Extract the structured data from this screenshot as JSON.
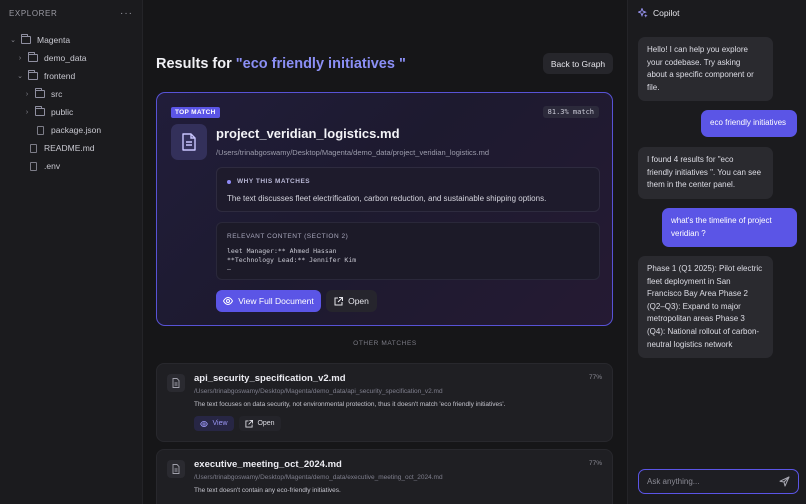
{
  "explorer": {
    "title": "EXPLORER",
    "more": "···",
    "tree": [
      {
        "label": "Magenta",
        "type": "folder",
        "chevron": "open"
      },
      {
        "label": "demo_data",
        "type": "folder",
        "chevron": "closed"
      },
      {
        "label": "frontend",
        "type": "folder",
        "chevron": "open"
      },
      {
        "label": "src",
        "type": "folder",
        "chevron": "closed"
      },
      {
        "label": "public",
        "type": "folder",
        "chevron": "closed"
      },
      {
        "label": "package.json",
        "type": "file"
      },
      {
        "label": "README.md",
        "type": "file"
      },
      {
        "label": ".env",
        "type": "file"
      }
    ]
  },
  "results": {
    "title_prefix": "Results for ",
    "query": "\"eco friendly initiatives \"",
    "back_label": "Back to Graph"
  },
  "top_match": {
    "badge": "TOP MATCH",
    "match": "81.3% match",
    "name": "project_veridian_logistics.md",
    "path": "/Users/trinabgoswamy/Desktop/Magenta/demo_data/project_veridian_logistics.md",
    "why_title": "WHY THIS MATCHES",
    "why_text": "The text discusses fleet electrification, carbon reduction, and sustainable shipping options.",
    "relevant_title": "RELEVANT CONTENT (SECTION 2)",
    "relevant_lines": [
      "leet Manager:** Ahmed Hassan",
      "**Technology Lead:** Jennifer Kim",
      "–"
    ],
    "view_label": "View Full Document",
    "open_label": "Open"
  },
  "other_label": "OTHER MATCHES",
  "other_matches": [
    {
      "name": "api_security_specification_v2.md",
      "pct": "77%",
      "path": "/Users/trinabgoswamy/Desktop/Magenta/demo_data/api_security_specification_v2.md",
      "text": "The text focuses on data security, not environmental protection, thus it doesn't match 'eco friendly initiatives'.",
      "view_label": "View",
      "open_label": "Open"
    },
    {
      "name": "executive_meeting_oct_2024.md",
      "pct": "77%",
      "path": "/Users/trinabgoswamy/Desktop/Magenta/demo_data/executive_meeting_oct_2024.md",
      "text": "The text doesn't contain any eco-friendly initiatives."
    }
  ],
  "copilot": {
    "title": "Copilot",
    "messages": [
      {
        "role": "bot",
        "lines": [
          "Hello! I can help you explore",
          "your codebase. Try asking",
          "about a specific component or",
          "file."
        ]
      },
      {
        "role": "user",
        "lines": [
          "eco friendly initiatives"
        ]
      },
      {
        "role": "bot",
        "lines": [
          "I found 4 results for \"eco",
          "friendly initiatives \". You can see",
          "them in the center panel."
        ]
      },
      {
        "role": "user",
        "lines": [
          "what's the timeline of project",
          "veridian ?"
        ]
      },
      {
        "role": "bot",
        "lines": [
          "Phase 1 (Q1 2025): Pilot electric",
          "fleet deployment in San",
          "Francisco Bay Area Phase 2",
          "(Q2–Q3): Expand to major",
          "metropolitan areas Phase 3",
          "(Q4): National rollout of carbon-",
          "neutral logistics network"
        ]
      }
    ],
    "input_placeholder": "Ask anything...",
    "input_value": ""
  },
  "colors": {
    "accent": "#5b55e6",
    "accent_text": "#8b8ff5"
  }
}
